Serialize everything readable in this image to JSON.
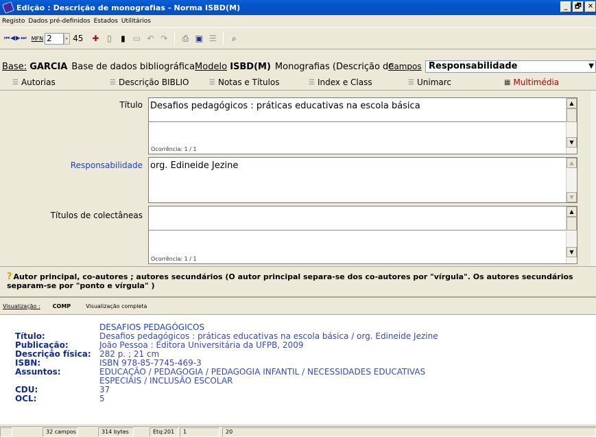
{
  "window": {
    "title": "Edição : Descrição de monografias - Norma ISBD(M)",
    "controls": [
      "_",
      "🗗",
      "✕"
    ]
  },
  "menu": [
    "Registo",
    "Dados pré-definidos",
    "Estados",
    "Utilitários"
  ],
  "toolbar": {
    "nav": "⏮ ◀ ▶ ⏭",
    "mfn_label": "MFN",
    "mfn_value": "2",
    "mfn_total": "45"
  },
  "base": {
    "label": "Base:",
    "name": "GARCIA",
    "description": "Base de dados bibliográfica",
    "model_label": "Modelo",
    "model_name": "ISBD(M)",
    "model_description": "Monografias (Descrição de",
    "campos_label": "Campos",
    "campos_value": "Responsabilidade"
  },
  "tabs": [
    {
      "label": "Autorias"
    },
    {
      "label": "Descrição BIBLIO"
    },
    {
      "label": "Notas e Títulos"
    },
    {
      "label": "Index e Class"
    },
    {
      "label": "Unimarc"
    },
    {
      "label": "Multimédia"
    }
  ],
  "fields": {
    "titulo": {
      "label": "Título",
      "value": "Desafios pedagógicos : práticas educativas na escola básica",
      "occurrence": "Ocorrência: 1 / 1"
    },
    "responsabilidade": {
      "label": "Responsabilidade",
      "value": "org. Edineide Jezine"
    },
    "colectaneas": {
      "label": "Títulos de colectâneas",
      "value": "",
      "occurrence": "Ocorrência: 1 / 1"
    }
  },
  "help": "Autor principal, co-autores ; autores secundários  (O autor principal separa-se dos co-autores por \"vírgula\".  Os autores secundários separam-se por \"ponto e vírgula\" )",
  "visualization": {
    "label": "Visualização :",
    "code": "COMP",
    "description": "Visualização completa",
    "heading": "DESAFIOS PEDAGÓGICOS",
    "rows": [
      {
        "key": "Título:",
        "value": "Desafios pedagógicos : práticas educativas na escola básica / org. Edineide Jezine"
      },
      {
        "key": "Publicação:",
        "value": "João Pessoa : Editora Universitária da UFPB, 2009"
      },
      {
        "key": "Descrição física:",
        "value": "282 p. ; 21 cm"
      },
      {
        "key": "ISBN:",
        "value": "ISBN 978-85-7745-469-3"
      },
      {
        "key": "Assuntos:",
        "value": "EDUCAÇÃO / PEDAGOGIA / PEDAGOGIA INFANTIL / NECESSIDADES EDUCATIVAS"
      },
      {
        "key": "",
        "value": "ESPECIAIS / INCLUSÃO ESCOLAR"
      },
      {
        "key": "CDU:",
        "value": "37"
      },
      {
        "key": "OCL:",
        "value": "5"
      }
    ]
  },
  "status": {
    "campos": "32 campos",
    "bytes": "314 bytes",
    "etq": "Etq:201",
    "a": "1",
    "b": "20"
  }
}
